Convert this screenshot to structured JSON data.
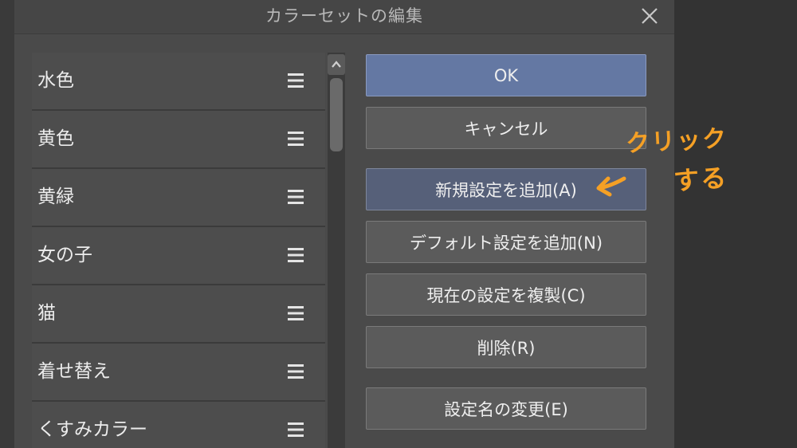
{
  "dialog": {
    "title": "カラーセットの編集"
  },
  "list": {
    "items": [
      {
        "label": "水色"
      },
      {
        "label": "黄色"
      },
      {
        "label": "黄緑"
      },
      {
        "label": "女の子"
      },
      {
        "label": "猫"
      },
      {
        "label": "着せ替え"
      },
      {
        "label": "くすみカラー"
      }
    ]
  },
  "buttons": {
    "ok": "OK",
    "cancel": "キャンセル",
    "add_new": "新規設定を追加(A)",
    "add_default": "デフォルト設定を追加(N)",
    "duplicate": "現在の設定を複製(C)",
    "delete": "削除(R)",
    "rename": "設定名の変更(E)"
  },
  "annotation": {
    "line1": "クリック",
    "line2": "する"
  },
  "colors": {
    "ok_button": "#6478a3",
    "add_button": "#566079",
    "annotation": "#f5a025"
  }
}
